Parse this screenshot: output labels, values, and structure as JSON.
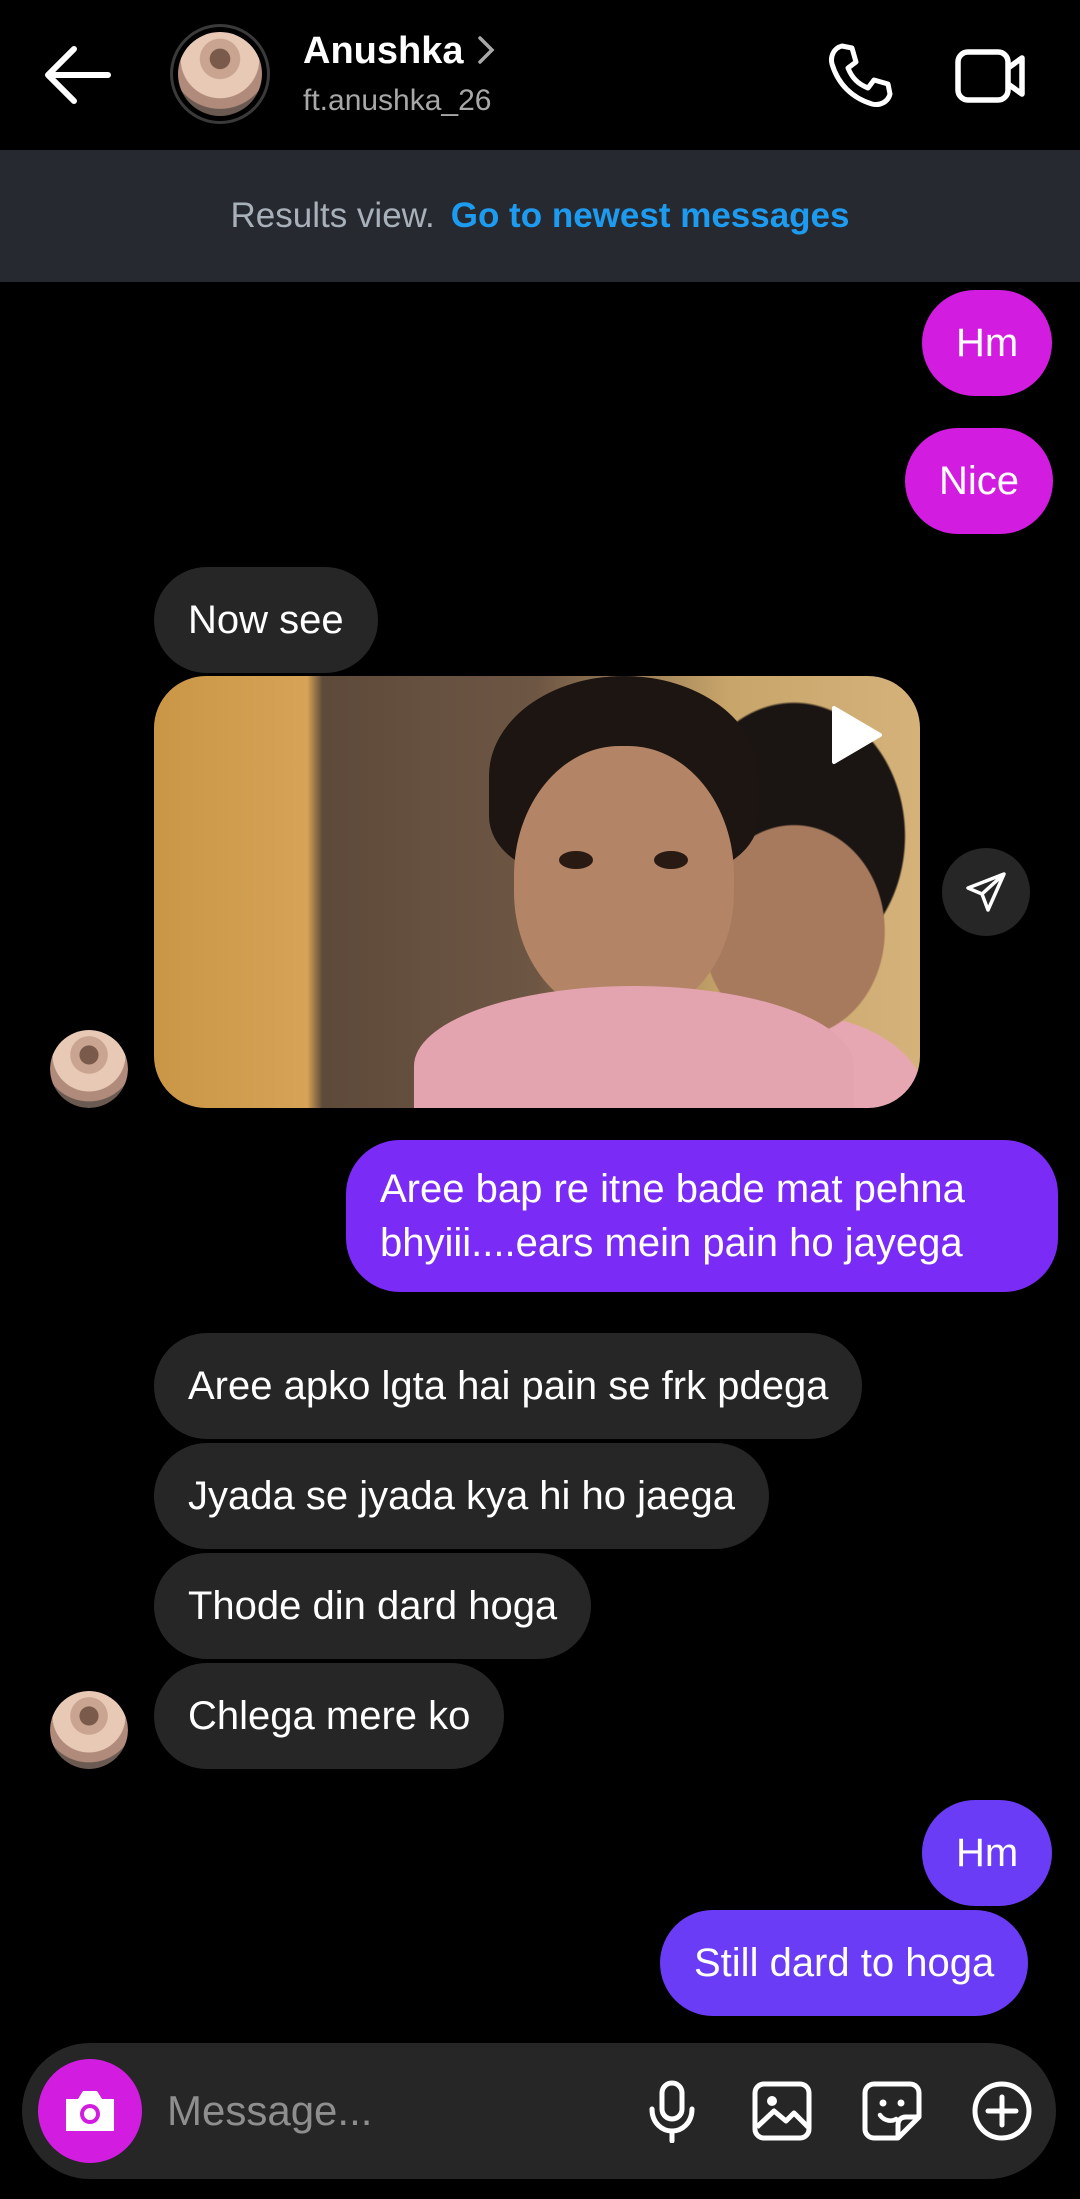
{
  "header": {
    "name": "Anushka",
    "username": "ft.anushka_26"
  },
  "banner": {
    "text": "Results view.",
    "link": "Go to newest messages"
  },
  "messages": {
    "m1": "Hm",
    "m2": "Nice",
    "m3": "Now see",
    "m4": "Aree bap re itne bade mat pehna bhyiii....ears mein pain ho jayega",
    "m5": "Aree apko lgta hai pain se frk pdega",
    "m6": "Jyada se jyada kya hi ho jaega",
    "m7": "Thode din dard hoga",
    "m8": "Chlega mere ko",
    "m9": "Hm",
    "m10": "Still dard to hoga"
  },
  "composer": {
    "placeholder": "Message..."
  },
  "colors": {
    "background": "#000000",
    "incoming_bubble": "#262626",
    "outgoing_pink": "#d21ce0",
    "outgoing_purple": "#7a2cf6",
    "outgoing_indigo": "#6b3cf5",
    "link": "#1d9bf0",
    "banner": "#262a30"
  },
  "icons": [
    "back-arrow-icon",
    "chevron-right-icon",
    "phone-icon",
    "video-camera-icon",
    "play-icon",
    "share-icon",
    "camera-icon",
    "microphone-icon",
    "gallery-icon",
    "sticker-icon",
    "plus-circle-icon"
  ]
}
